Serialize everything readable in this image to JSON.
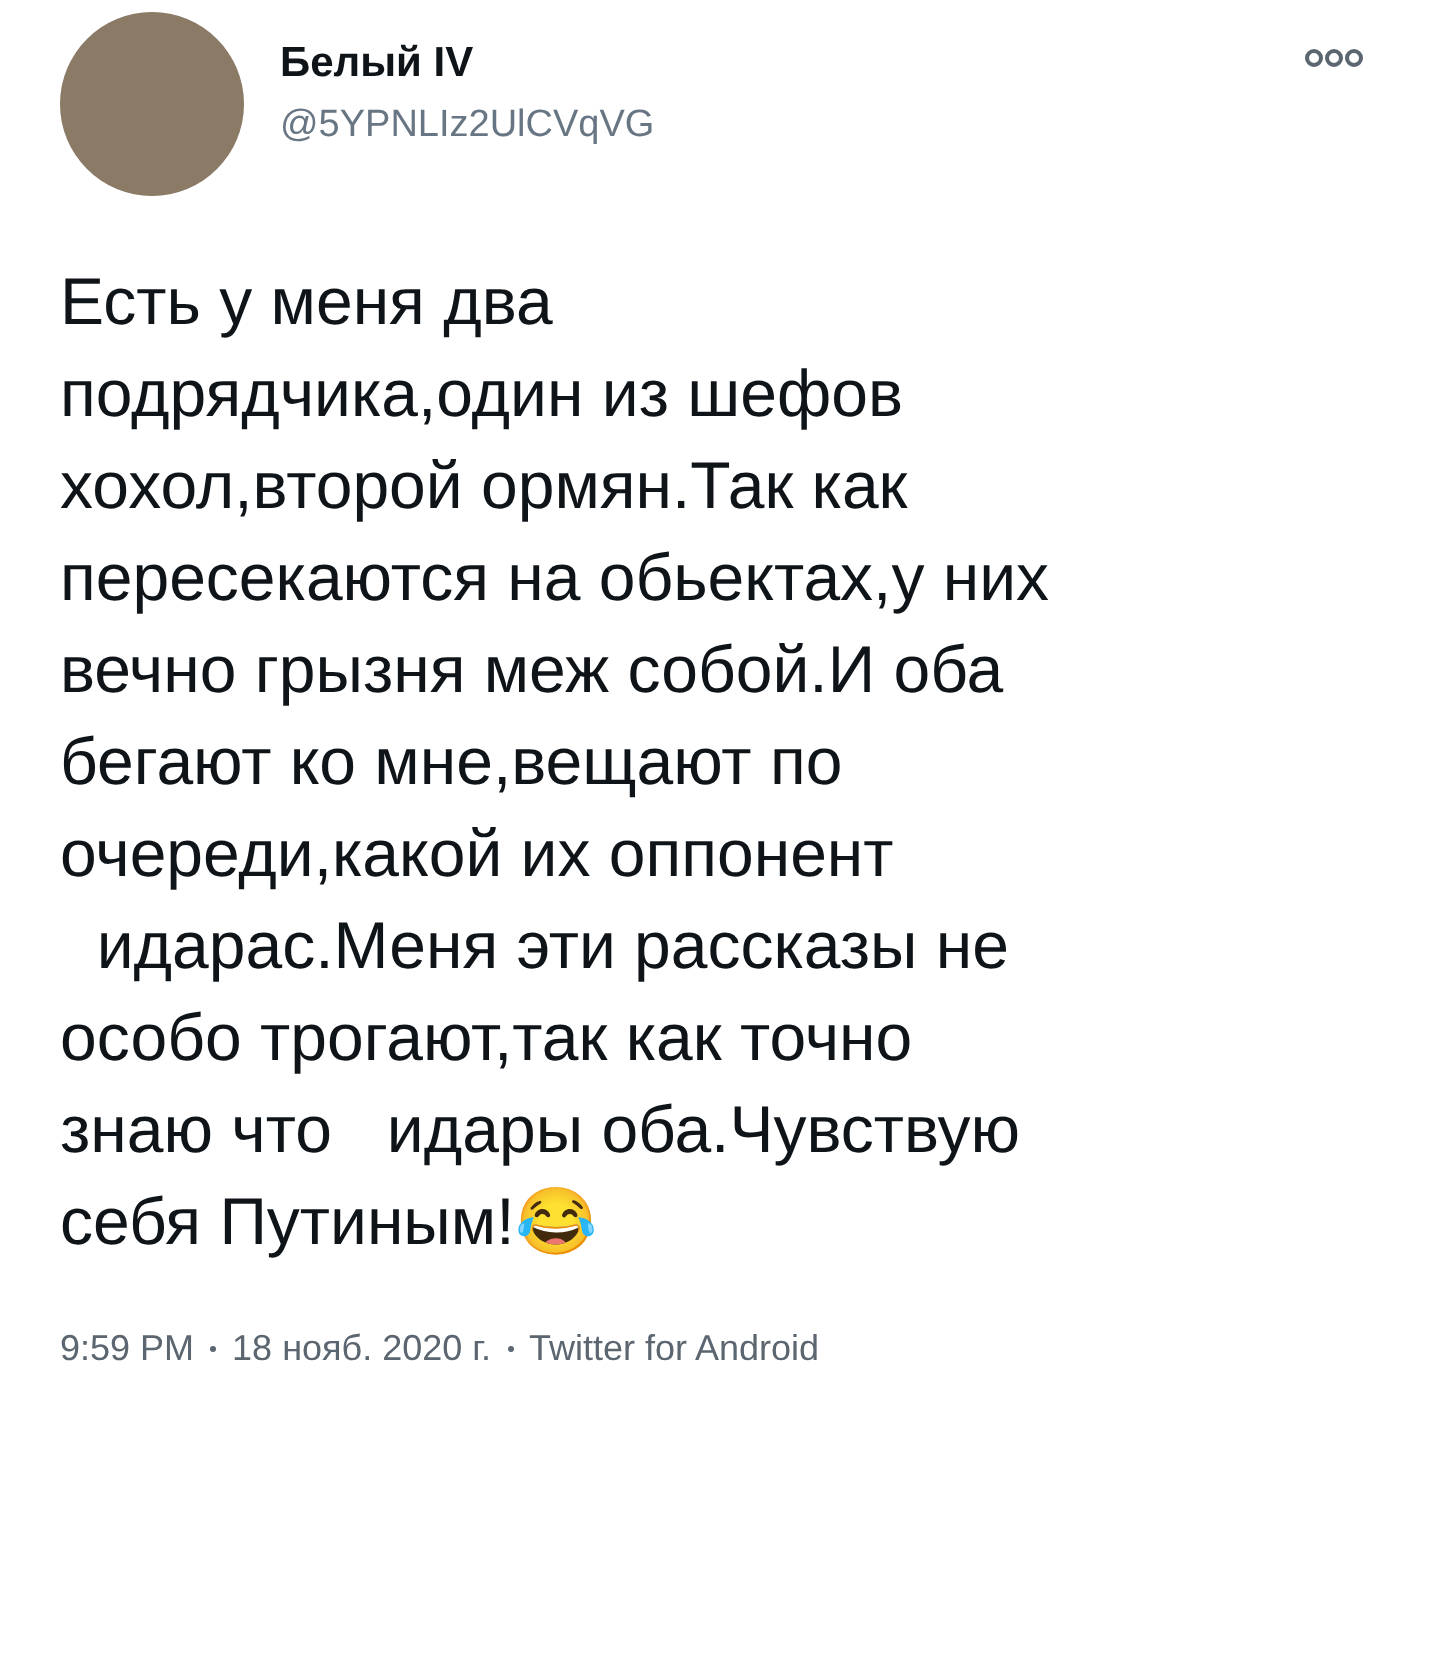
{
  "author": {
    "name": "Белый IV",
    "handle": "@5YPNLIz2UlCVqVG"
  },
  "body_lines": [
    "Есть у меня два",
    "подрядчика,один из шефов",
    "хохол,второй ормян.Так как",
    "пересекаются на обьектах,у них",
    "вечно грызня меж собой.И оба",
    "бегают ко мне,вещают по",
    "очереди,какой их оппонент",
    "  идарас.Меня эти рассказы не",
    "особо трогают,так как точно",
    "знаю что   идары оба.Чувствую",
    "себя Путиным!😂"
  ],
  "footer": {
    "time": "9:59 PM",
    "date": "18 нояб. 2020 г.",
    "source": "Twitter for Android"
  }
}
